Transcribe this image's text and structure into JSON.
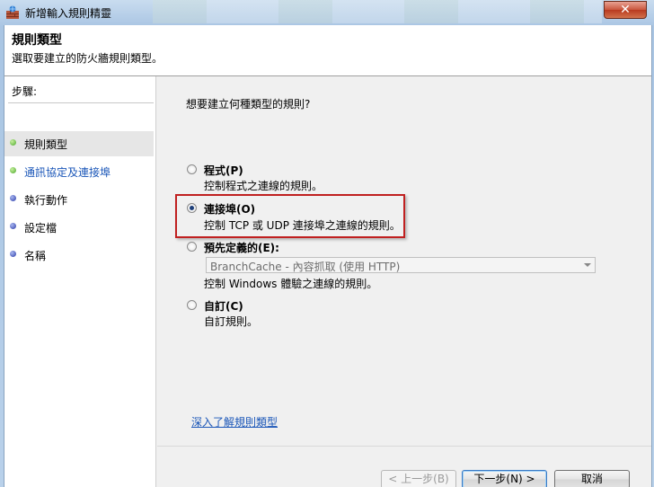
{
  "window": {
    "title": "新增輸入規則精靈",
    "close_label": "✕"
  },
  "header": {
    "title": "規則類型",
    "subtitle": "選取要建立的防火牆規則類型。"
  },
  "steps": {
    "title": "步驟:",
    "items": [
      {
        "label": "規則類型",
        "state": "done",
        "color": "#4aa82a"
      },
      {
        "label": "通訊協定及連接埠",
        "state": "link",
        "color": "#4aa82a"
      },
      {
        "label": "執行動作",
        "state": "pending",
        "color": "#2a3aa8"
      },
      {
        "label": "設定檔",
        "state": "pending",
        "color": "#2a3aa8"
      },
      {
        "label": "名稱",
        "state": "pending",
        "color": "#2a3aa8"
      }
    ]
  },
  "main": {
    "question": "想要建立何種類型的規則?",
    "options": [
      {
        "label": "程式(P)",
        "desc": "控制程式之連線的規則。",
        "checked": false
      },
      {
        "label": "連接埠(O)",
        "desc": "控制 TCP 或 UDP 連接埠之連線的規則。",
        "checked": true
      },
      {
        "label": "預先定義的(E):",
        "desc": "控制 Windows 體驗之連線的規則。",
        "checked": false
      },
      {
        "label": "自訂(C)",
        "desc": "自訂規則。",
        "checked": false
      }
    ],
    "predefined_select": "BranchCache - 內容抓取 (使用 HTTP)",
    "learn_more_link": "深入了解規則類型"
  },
  "buttons": {
    "back": "< 上一步(B)",
    "next": "下一步(N) >",
    "cancel": "取消"
  },
  "colors": {
    "accent_link": "#1a56b8",
    "highlight_border": "#c02020"
  }
}
